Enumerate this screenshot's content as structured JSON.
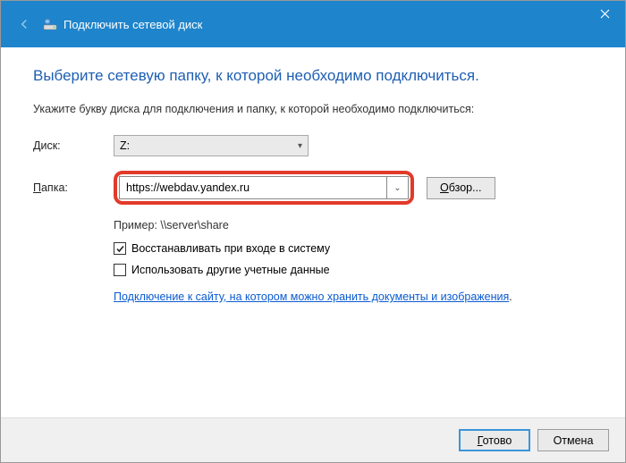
{
  "titlebar": {
    "title": "Подключить сетевой диск"
  },
  "content": {
    "heading": "Выберите сетевую папку, к которой необходимо подключиться.",
    "instruction": "Укажите букву диска для подключения и папку, к которой необходимо подключиться:",
    "drive_label_pre": "Д",
    "drive_label_post": "иск:",
    "drive_value": "Z:",
    "folder_label_pre": "П",
    "folder_label_post": "апка:",
    "folder_value": "https://webdav.yandex.ru",
    "browse_label_pre": "О",
    "browse_label_post": "бзор...",
    "example": "Пример: \\\\server\\share",
    "checkbox_reconnect": "Восстанавливать при входе в систему",
    "checkbox_creds": "Использовать другие учетные данные",
    "link": "Подключение к сайту, на котором можно хранить документы и изображения",
    "link_period": "."
  },
  "footer": {
    "finish_pre": "Г",
    "finish_post": "отово",
    "cancel": "Отмена"
  }
}
